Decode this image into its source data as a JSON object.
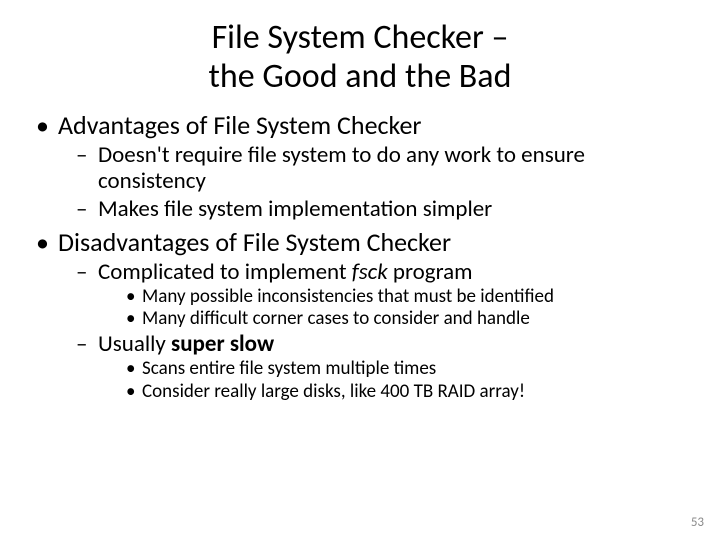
{
  "title": {
    "line1": "File System Checker –",
    "line2": "the Good and the Bad"
  },
  "bullets": {
    "adv_heading": "Advantages of File System Checker",
    "adv_sub1": "Doesn't require file system to do any work to ensure consistency",
    "adv_sub2": "Makes file system implementation simpler",
    "dis_heading": "Disadvantages of File System Checker",
    "dis_sub1_pre": "Complicated to implement ",
    "dis_sub1_em": "fsck",
    "dis_sub1_post": " program",
    "dis_sub1_b1": "Many possible inconsistencies that must be identified",
    "dis_sub1_b2": "Many difficult corner cases to consider and handle",
    "dis_sub2_pre": "Usually ",
    "dis_sub2_em": "super slow",
    "dis_sub2_b1": "Scans entire file system multiple times",
    "dis_sub2_b2": "Consider really large disks, like 400 TB RAID array!"
  },
  "page_number": "53"
}
